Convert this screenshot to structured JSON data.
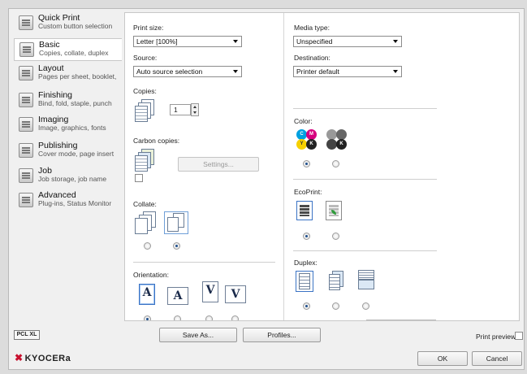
{
  "sidebar": {
    "items": [
      {
        "title": "Quick Print",
        "subtitle": "Custom button selection"
      },
      {
        "title": "Basic",
        "subtitle": "Copies, collate, duplex"
      },
      {
        "title": "Layout",
        "subtitle": "Pages per sheet, booklet,"
      },
      {
        "title": "Finishing",
        "subtitle": "Bind, fold, staple, punch"
      },
      {
        "title": "Imaging",
        "subtitle": "Image, graphics, fonts"
      },
      {
        "title": "Publishing",
        "subtitle": "Cover mode, page insert"
      },
      {
        "title": "Job",
        "subtitle": "Job storage, job name"
      },
      {
        "title": "Advanced",
        "subtitle": "Plug-ins, Status Monitor"
      }
    ]
  },
  "left": {
    "print_size_label": "Print size:",
    "print_size_value": "Letter [100%]",
    "source_label": "Source:",
    "source_value": "Auto source selection",
    "copies_label": "Copies:",
    "copies_value": "1",
    "carbon_label": "Carbon copies:",
    "settings_button": "Settings...",
    "collate_label": "Collate:",
    "orientation_label": "Orientation:",
    "orientation_glyphs": [
      "A",
      "A",
      "V",
      "V"
    ]
  },
  "right": {
    "media_type_label": "Media type:",
    "media_type_value": "Unspecified",
    "destination_label": "Destination:",
    "destination_value": "Printer default",
    "color_label": "Color:",
    "color_circles": [
      "C",
      "M",
      "Y",
      "K"
    ],
    "mono_circle": "K",
    "ecoprint_label": "EcoPrint:",
    "duplex_label": "Duplex:"
  },
  "footer": {
    "pcl_badge": "PCL XL",
    "save_as_button": "Save As...",
    "profiles_button": "Profiles...",
    "print_preview_label": "Print preview",
    "logo_text": "KYOCERa",
    "ok_button": "OK",
    "cancel_button": "Cancel"
  },
  "colors": {
    "cyan": "#00a0e0",
    "magenta": "#d6007e",
    "yellow": "#f6d000",
    "black": "#222222",
    "kyocera_red": "#c8102e"
  }
}
